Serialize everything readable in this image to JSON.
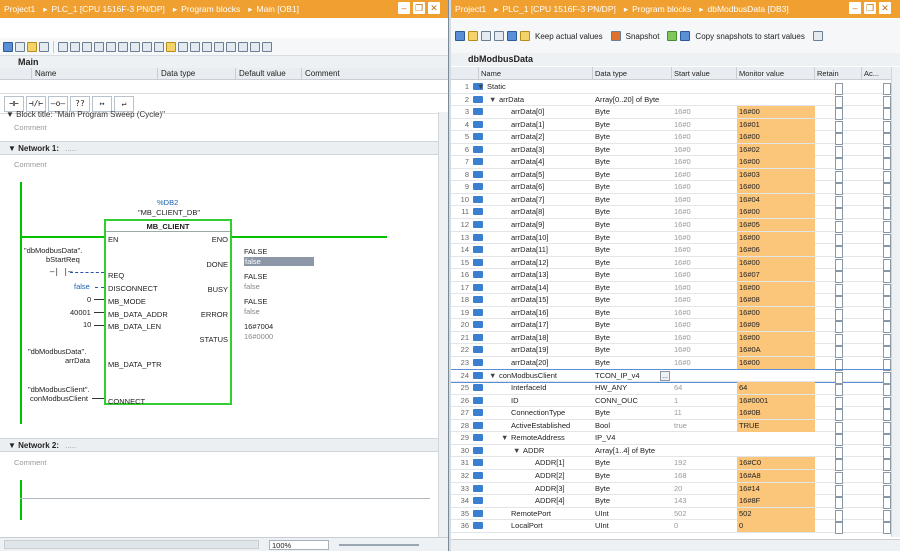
{
  "left": {
    "breadcrumb": [
      "Project1",
      "PLC_1 [CPU 1516F-3 PN/DP]",
      "Program blocks",
      "Main [OB1]"
    ],
    "panel_title": "Main",
    "iface_headers": [
      "Name",
      "Data type",
      "Default value",
      "Comment"
    ],
    "ladder_buttons": [
      "⊣⊢",
      "⊣/⊢",
      "–o–",
      "??",
      "↦",
      "↵"
    ],
    "block_title": "Block title:  \"Main Program Sweep (Cycle)\"",
    "comment": "Comment",
    "network1": "Network 1:",
    "network2": "Network 2:",
    "dots": ".....",
    "instance": {
      "addr": "%DB2",
      "name": "\"MB_CLIENT_DB\"",
      "type": "MB_CLIENT"
    },
    "inputs": {
      "en": "EN",
      "req": "REQ",
      "disconnect": "DISCONNECT",
      "mb_mode": "MB_MODE",
      "mb_data_addr": "MB_DATA_ADDR",
      "mb_data_len": "MB_DATA_LEN",
      "mb_data_ptr": "MB_DATA_PTR",
      "connect": "CONNECT"
    },
    "outputs": {
      "eno": "ENO",
      "done": "DONE",
      "busy": "BUSY",
      "error": "ERROR",
      "status": "STATUS"
    },
    "in_values": {
      "req_tag": "\"dbModbusData\".",
      "req_tag2": "bStartReq",
      "disconnect": "false",
      "mb_mode": "0",
      "mb_data_addr": "40001",
      "mb_data_len": "10",
      "ptr_tag": "\"dbModbusData\".",
      "ptr_tag2": "arrData",
      "conn_tag": "\"dbModbusClient\".",
      "conn_tag2": "conModbusClient"
    },
    "out_values": {
      "done_act": "FALSE",
      "done_val": "false",
      "busy_act": "FALSE",
      "busy_val": "false",
      "error_act": "FALSE",
      "error_val": "false",
      "status_act": "16#7004",
      "status_val": "16#0000"
    },
    "zoom": "100%"
  },
  "right": {
    "breadcrumb": [
      "Project1",
      "PLC_1 [CPU 1516F-3 PN/DP]",
      "Program blocks",
      "dbModbusData [DB3]"
    ],
    "toolbar": {
      "keep": "Keep actual values",
      "snapshot": "Snapshot",
      "copy": "Copy snapshots to start values"
    },
    "db_title": "dbModbusData",
    "headers": [
      "Name",
      "Data type",
      "Start value",
      "Monitor value",
      "Retain",
      "Ac..."
    ],
    "rows": [
      {
        "n": "1",
        "name": "Static",
        "indent": 0,
        "type": "",
        "start": "",
        "mon": "",
        "chev": "▼"
      },
      {
        "n": "2",
        "name": "arrData",
        "indent": 1,
        "type": "Array[0..20] of Byte",
        "start": "",
        "mon": "",
        "chev": "▼"
      },
      {
        "n": "3",
        "name": "arrData[0]",
        "indent": 2,
        "type": "Byte",
        "start": "16#0",
        "mon": "16#00"
      },
      {
        "n": "4",
        "name": "arrData[1]",
        "indent": 2,
        "type": "Byte",
        "start": "16#0",
        "mon": "16#01"
      },
      {
        "n": "5",
        "name": "arrData[2]",
        "indent": 2,
        "type": "Byte",
        "start": "16#0",
        "mon": "16#00"
      },
      {
        "n": "6",
        "name": "arrData[3]",
        "indent": 2,
        "type": "Byte",
        "start": "16#0",
        "mon": "16#02"
      },
      {
        "n": "7",
        "name": "arrData[4]",
        "indent": 2,
        "type": "Byte",
        "start": "16#0",
        "mon": "16#00"
      },
      {
        "n": "8",
        "name": "arrData[5]",
        "indent": 2,
        "type": "Byte",
        "start": "16#0",
        "mon": "16#03"
      },
      {
        "n": "9",
        "name": "arrData[6]",
        "indent": 2,
        "type": "Byte",
        "start": "16#0",
        "mon": "16#00"
      },
      {
        "n": "10",
        "name": "arrData[7]",
        "indent": 2,
        "type": "Byte",
        "start": "16#0",
        "mon": "16#04"
      },
      {
        "n": "11",
        "name": "arrData[8]",
        "indent": 2,
        "type": "Byte",
        "start": "16#0",
        "mon": "16#00"
      },
      {
        "n": "12",
        "name": "arrData[9]",
        "indent": 2,
        "type": "Byte",
        "start": "16#0",
        "mon": "16#05"
      },
      {
        "n": "13",
        "name": "arrData[10]",
        "indent": 2,
        "type": "Byte",
        "start": "16#0",
        "mon": "16#00"
      },
      {
        "n": "14",
        "name": "arrData[11]",
        "indent": 2,
        "type": "Byte",
        "start": "16#0",
        "mon": "16#06"
      },
      {
        "n": "15",
        "name": "arrData[12]",
        "indent": 2,
        "type": "Byte",
        "start": "16#0",
        "mon": "16#00"
      },
      {
        "n": "16",
        "name": "arrData[13]",
        "indent": 2,
        "type": "Byte",
        "start": "16#0",
        "mon": "16#07"
      },
      {
        "n": "17",
        "name": "arrData[14]",
        "indent": 2,
        "type": "Byte",
        "start": "16#0",
        "mon": "16#00"
      },
      {
        "n": "18",
        "name": "arrData[15]",
        "indent": 2,
        "type": "Byte",
        "start": "16#0",
        "mon": "16#08"
      },
      {
        "n": "19",
        "name": "arrData[16]",
        "indent": 2,
        "type": "Byte",
        "start": "16#0",
        "mon": "16#00"
      },
      {
        "n": "20",
        "name": "arrData[17]",
        "indent": 2,
        "type": "Byte",
        "start": "16#0",
        "mon": "16#09"
      },
      {
        "n": "21",
        "name": "arrData[18]",
        "indent": 2,
        "type": "Byte",
        "start": "16#0",
        "mon": "16#00"
      },
      {
        "n": "22",
        "name": "arrData[19]",
        "indent": 2,
        "type": "Byte",
        "start": "16#0",
        "mon": "16#0A"
      },
      {
        "n": "23",
        "name": "arrData[20]",
        "indent": 2,
        "type": "Byte",
        "start": "16#0",
        "mon": "16#00"
      },
      {
        "n": "24",
        "name": "conModbusClient",
        "indent": 1,
        "type": "TCON_IP_v4",
        "start": "",
        "mon": "",
        "chev": "▼",
        "sel": true
      },
      {
        "n": "25",
        "name": "InterfaceId",
        "indent": 2,
        "type": "HW_ANY",
        "start": "64",
        "mon": "64"
      },
      {
        "n": "26",
        "name": "ID",
        "indent": 2,
        "type": "CONN_OUC",
        "start": "1",
        "mon": "16#0001"
      },
      {
        "n": "27",
        "name": "ConnectionType",
        "indent": 2,
        "type": "Byte",
        "start": "11",
        "mon": "16#0B"
      },
      {
        "n": "28",
        "name": "ActiveEstablished",
        "indent": 2,
        "type": "Bool",
        "start": "true",
        "mon": "TRUE"
      },
      {
        "n": "29",
        "name": "RemoteAddress",
        "indent": 2,
        "type": "IP_V4",
        "start": "",
        "mon": "",
        "chev": "▼"
      },
      {
        "n": "30",
        "name": "ADDR",
        "indent": 3,
        "type": "Array[1..4] of Byte",
        "start": "",
        "mon": "",
        "chev": "▼"
      },
      {
        "n": "31",
        "name": "ADDR[1]",
        "indent": 4,
        "type": "Byte",
        "start": "192",
        "mon": "16#C0"
      },
      {
        "n": "32",
        "name": "ADDR[2]",
        "indent": 4,
        "type": "Byte",
        "start": "168",
        "mon": "16#A8"
      },
      {
        "n": "33",
        "name": "ADDR[3]",
        "indent": 4,
        "type": "Byte",
        "start": "20",
        "mon": "16#14"
      },
      {
        "n": "34",
        "name": "ADDR[4]",
        "indent": 4,
        "type": "Byte",
        "start": "143",
        "mon": "16#8F"
      },
      {
        "n": "35",
        "name": "RemotePort",
        "indent": 2,
        "type": "UInt",
        "start": "502",
        "mon": "502"
      },
      {
        "n": "36",
        "name": "LocalPort",
        "indent": 2,
        "type": "UInt",
        "start": "0",
        "mon": "0"
      }
    ]
  }
}
